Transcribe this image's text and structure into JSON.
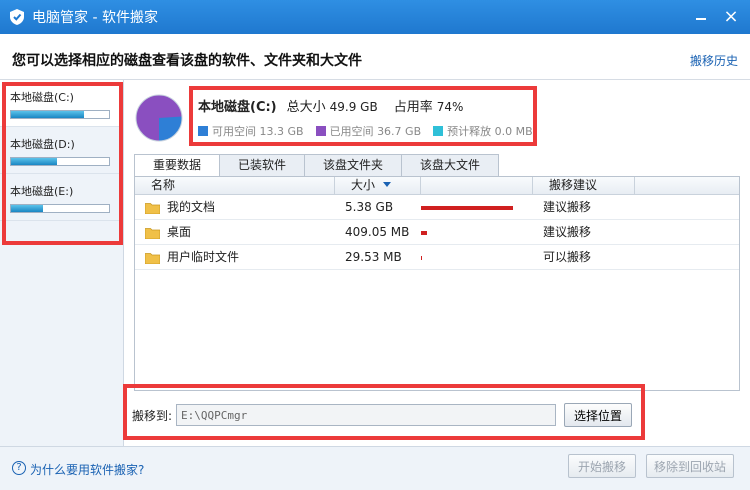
{
  "window": {
    "title": "电脑管家 - 软件搬家",
    "close_glyph": "×"
  },
  "header": {
    "headline": "您可以选择相应的磁盘查看该盘的软件、文件夹和大文件",
    "history_link": "搬移历史"
  },
  "drives": [
    {
      "label": "本地磁盘(C:)",
      "usage_fraction": 0.74
    },
    {
      "label": "本地磁盘(D:)",
      "usage_fraction": 0.47
    },
    {
      "label": "本地磁盘(E:)",
      "usage_fraction": 0.33
    }
  ],
  "summary": {
    "drive_name": "本地磁盘(C:)",
    "total_label": "总大小",
    "total_value": "49.9 GB",
    "usage_label": "占用率",
    "usage_value": "74%",
    "usage_fraction": 0.74,
    "legend": [
      {
        "label": "可用空间",
        "value": "13.3 GB",
        "color": "#2e7fd6"
      },
      {
        "label": "已用空间",
        "value": "36.7 GB",
        "color": "#8a4fc0"
      },
      {
        "label": "预计释放",
        "value": "0.0 MB",
        "color": "#2fc0d8"
      }
    ]
  },
  "tabs": [
    {
      "label": "重要数据",
      "active": true
    },
    {
      "label": "已装软件",
      "active": false
    },
    {
      "label": "该盘文件夹",
      "active": false
    },
    {
      "label": "该盘大文件",
      "active": false
    }
  ],
  "table": {
    "columns": {
      "name": "名称",
      "size": "大小",
      "advice": "搬移建议"
    },
    "rows": [
      {
        "name": "我的文档",
        "size": "5.38 GB",
        "advice": "建议搬移",
        "bar_fraction": 1.0
      },
      {
        "name": "桌面",
        "size": "409.05 MB",
        "advice": "建议搬移",
        "bar_fraction": 0.06
      },
      {
        "name": "用户临时文件",
        "size": "29.53 MB",
        "advice": "可以搬移",
        "bar_fraction": 0.01
      }
    ]
  },
  "move_to": {
    "label": "搬移到:",
    "path": "E:\\QQPCmgr",
    "choose_button": "选择位置"
  },
  "footer": {
    "help_glyph": "?",
    "help_link": "为什么要用软件搬家?",
    "start_button": "开始搬移",
    "recycle_button": "移除到回收站"
  },
  "colors": {
    "titlebar": "#1f78cf",
    "link": "#1a62b3",
    "highlight_box": "#ec3a3a",
    "size_bar": "#d02020"
  }
}
